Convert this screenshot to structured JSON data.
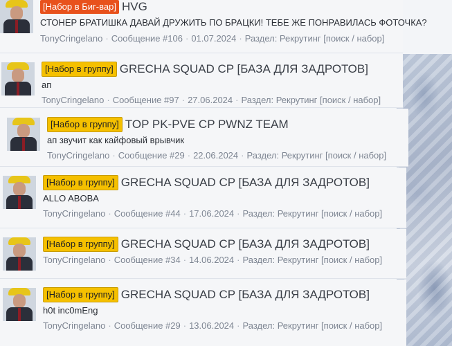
{
  "posts": [
    {
      "prefix": "[Набор в Биг-вар]",
      "prefix_type": "bigwar",
      "title": "HVG",
      "snippet": "СТОНЕР БРАТИШКА ДАВАЙ ДРУЖИТЬ ПО БРАЦКИ! ТЕБЕ ЖЕ ПОНРАВИЛАСЬ ФОТОЧКА?",
      "author": "TonyCringelano",
      "message": "Сообщение #106",
      "date": "01.07.2024",
      "section": "Раздел: Рекрутинг [поиск / набор]"
    },
    {
      "prefix": "[Набор в группу]",
      "prefix_type": "group",
      "title": "GRECHA SQUAD CP [БАЗА ДЛЯ ЗАДРОТОВ]",
      "snippet": "ап",
      "author": "TonyCringelano",
      "message": "Сообщение #97",
      "date": "27.06.2024",
      "section": "Раздел: Рекрутинг [поиск / набор]"
    },
    {
      "prefix": "[Набор в группу]",
      "prefix_type": "group",
      "title": "TOP PK-PVE CP PWNZ TEAM",
      "snippet": "ап звучит как кайфовый врывчик",
      "author": "TonyCringelano",
      "message": "Сообщение #29",
      "date": "22.06.2024",
      "section": "Раздел: Рекрутинг [поиск / набор]"
    },
    {
      "prefix": "[Набор в группу]",
      "prefix_type": "group",
      "title": "GRECHA SQUAD CP [БАЗА ДЛЯ ЗАДРОТОВ]",
      "snippet": "ALLO ABOBA",
      "author": "TonyCringelano",
      "message": "Сообщение #44",
      "date": "17.06.2024",
      "section": "Раздел: Рекрутинг [поиск / набор]"
    },
    {
      "prefix": "[Набор в группу]",
      "prefix_type": "group",
      "title": "GRECHA SQUAD CP [БАЗА ДЛЯ ЗАДРОТОВ]",
      "snippet": "",
      "author": "TonyCringelano",
      "message": "Сообщение #34",
      "date": "14.06.2024",
      "section": "Раздел: Рекрутинг [поиск / набор]"
    },
    {
      "prefix": "[Набор в группу]",
      "prefix_type": "group",
      "title": "GRECHA SQUAD CP [БАЗА ДЛЯ ЗАДРОТОВ]",
      "snippet": "h0t inc0mEng",
      "author": "TonyCringelano",
      "message": "Сообщение #29",
      "date": "13.06.2024",
      "section": "Раздел: Рекрутинг [поиск / набор]"
    }
  ],
  "meta_separator": "·",
  "colors": {
    "prefix_bigwar": "#e8511c",
    "prefix_group": "#f5c000",
    "meta_text": "#7d8592"
  }
}
